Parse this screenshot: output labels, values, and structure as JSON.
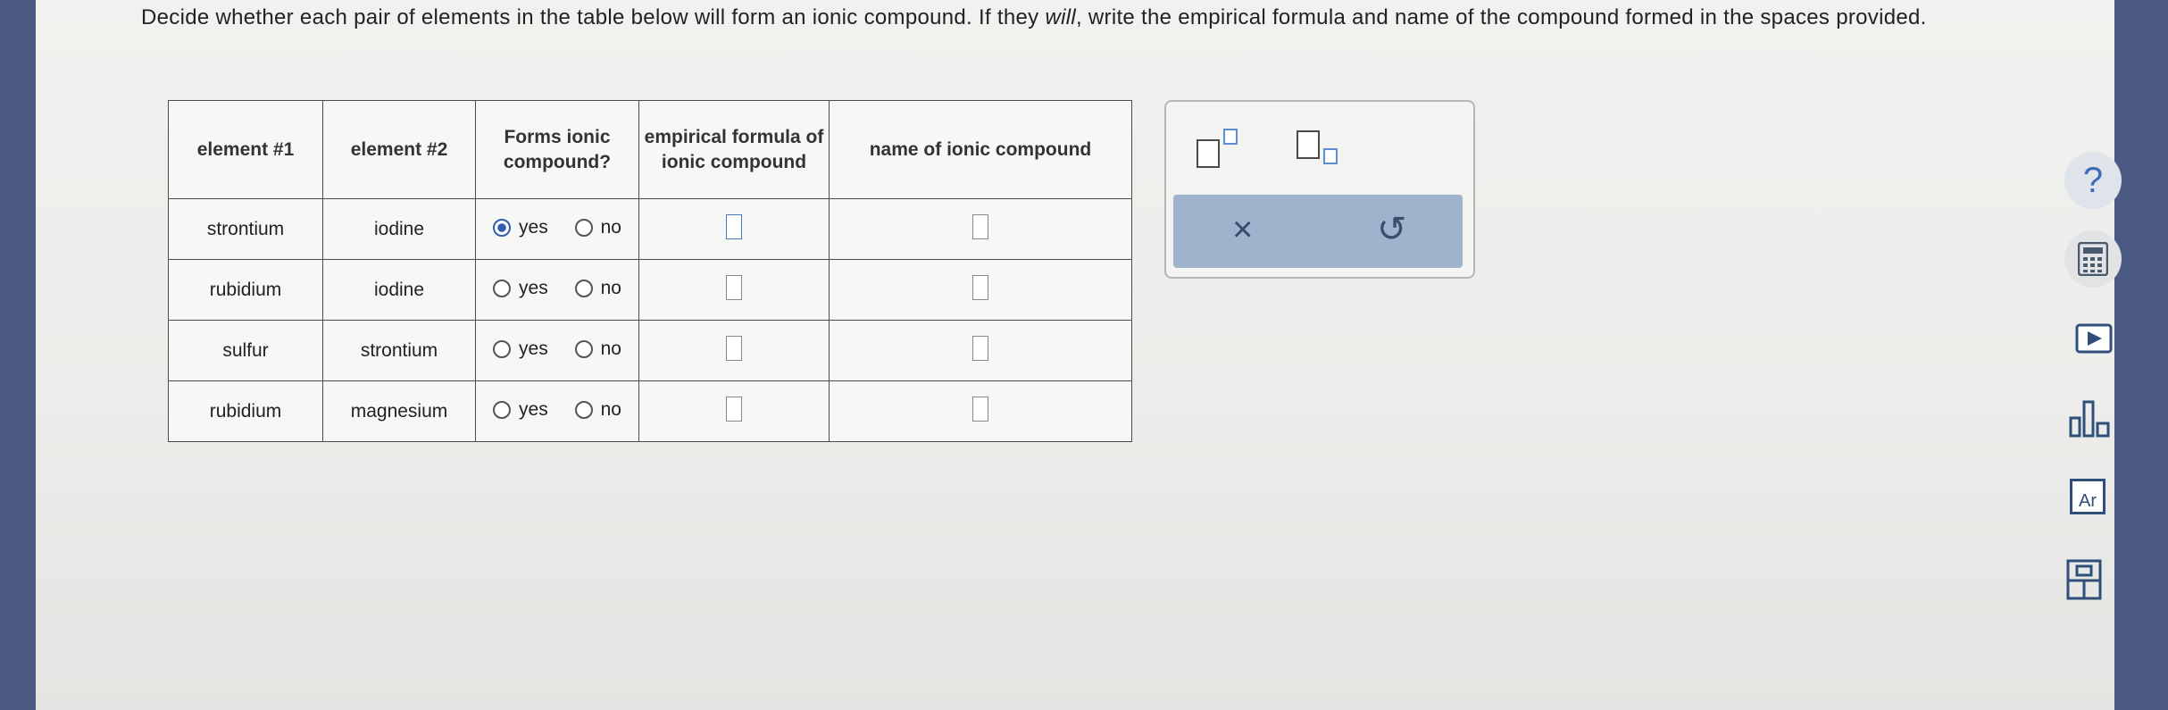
{
  "instructions": {
    "part1": "Decide whether each pair of elements in the table below will form an ionic compound. If they ",
    "emph": "will",
    "part2": ", write the empirical formula and name of the compound formed in the spaces provided."
  },
  "table": {
    "headers": [
      "element #1",
      "element #2",
      "Forms ionic compound?",
      "empirical formula of ionic compound",
      "name of ionic compound"
    ],
    "rows": [
      {
        "element1": "strontium",
        "element2": "iodine",
        "yes_label": "yes",
        "no_label": "no",
        "selected": "yes"
      },
      {
        "element1": "rubidium",
        "element2": "iodine",
        "yes_label": "yes",
        "no_label": "no",
        "selected": ""
      },
      {
        "element1": "sulfur",
        "element2": "strontium",
        "yes_label": "yes",
        "no_label": "no",
        "selected": ""
      },
      {
        "element1": "rubidium",
        "element2": "magnesium",
        "yes_label": "yes",
        "no_label": "no",
        "selected": ""
      }
    ]
  },
  "panel": {
    "tools": [
      "superscript-template",
      "subscript-template"
    ],
    "clear_glyph": "×",
    "undo_glyph": "↺"
  },
  "sidebar": {
    "help_glyph": "?",
    "items": [
      "help",
      "calculator",
      "video",
      "chart",
      "periodic-table",
      "reference"
    ],
    "periodic_label": "Ar"
  },
  "colors": {
    "accent": "#2f5fae",
    "action_bar": "#9fb4cc",
    "help": "#3f6cb8"
  }
}
